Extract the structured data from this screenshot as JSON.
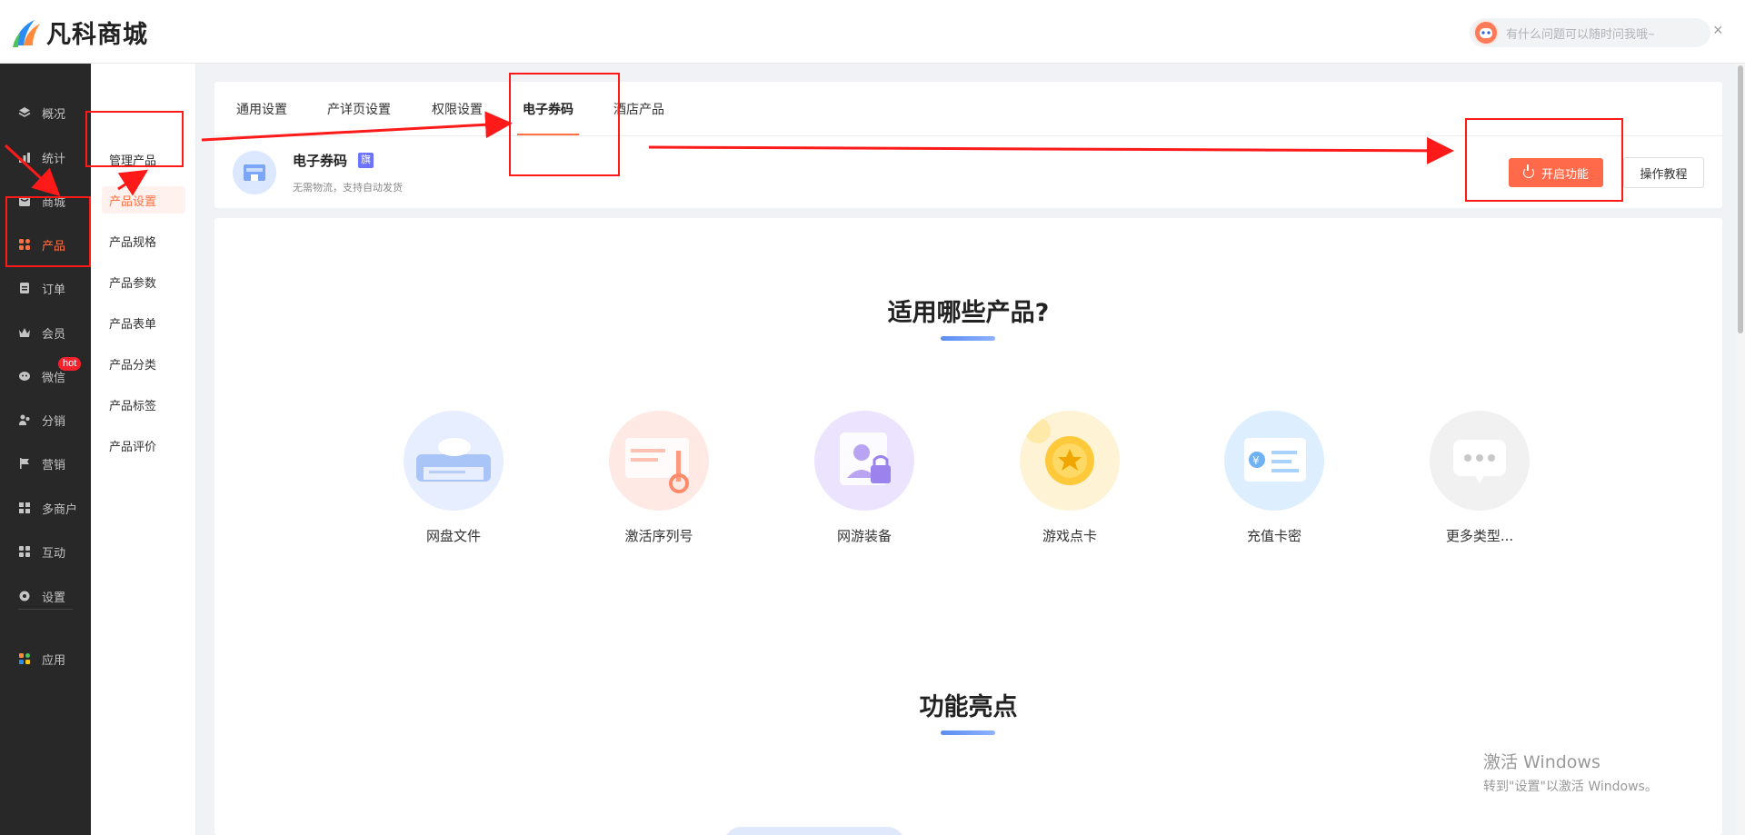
{
  "header": {
    "logo_text": "凡科商城",
    "ask_placeholder": "有什么问题可以随时问我哦~",
    "close_label": "×"
  },
  "sidebar": {
    "items": [
      {
        "label": "概况",
        "icon": "layers-icon"
      },
      {
        "label": "统计",
        "icon": "chart-icon"
      },
      {
        "label": "商城",
        "icon": "store-icon"
      },
      {
        "label": "产品",
        "icon": "grid-icon",
        "active": true
      },
      {
        "label": "订单",
        "icon": "order-icon"
      },
      {
        "label": "会员",
        "icon": "crown-icon"
      },
      {
        "label": "微信",
        "icon": "wechat-icon"
      },
      {
        "label": "分销",
        "icon": "people-icon"
      },
      {
        "label": "营销",
        "icon": "flag-icon"
      },
      {
        "label": "多商户",
        "icon": "shop-icon"
      },
      {
        "label": "互动",
        "icon": "interact-icon"
      },
      {
        "label": "设置",
        "icon": "gear-icon"
      },
      {
        "label": "应用",
        "icon": "apps-icon"
      }
    ],
    "hot_badge": "hot"
  },
  "submenu": {
    "items": [
      "管理产品",
      "产品设置",
      "产品规格",
      "产品参数",
      "产品表单",
      "产品分类",
      "产品标签",
      "产品评价"
    ],
    "active_index": 1
  },
  "tabs": {
    "items": [
      "通用设置",
      "产详页设置",
      "权限设置",
      "电子券码",
      "酒店产品"
    ],
    "active_index": 3
  },
  "feature": {
    "title": "电子券码",
    "flag": "旗",
    "desc": "无需物流，支持自动发货",
    "enable_label": "开启功能",
    "guide_label": "操作教程"
  },
  "main": {
    "section1_title": "适用哪些产品?",
    "product_types": [
      {
        "label": "网盘文件",
        "icon": "cloud-drive-icon",
        "color": "#e3ecff"
      },
      {
        "label": "激活序列号",
        "icon": "key-card-icon",
        "color": "#ffe6e0"
      },
      {
        "label": "网游装备",
        "icon": "game-account-icon",
        "color": "#ece4ff"
      },
      {
        "label": "游戏点卡",
        "icon": "coin-icon",
        "color": "#fff3d6"
      },
      {
        "label": "充值卡密",
        "icon": "recharge-card-icon",
        "color": "#e0f0ff"
      },
      {
        "label": "更多类型...",
        "icon": "chat-dots-icon",
        "color": "#f1f1f1"
      }
    ],
    "section2_title": "功能亮点"
  },
  "watermark": {
    "line1": "激活 Windows",
    "line2": "转到\"设置\"以激活 Windows。"
  },
  "colors": {
    "accent": "#ff7043",
    "annotation": "#ff1a1a",
    "sidebar_bg": "#282828"
  }
}
